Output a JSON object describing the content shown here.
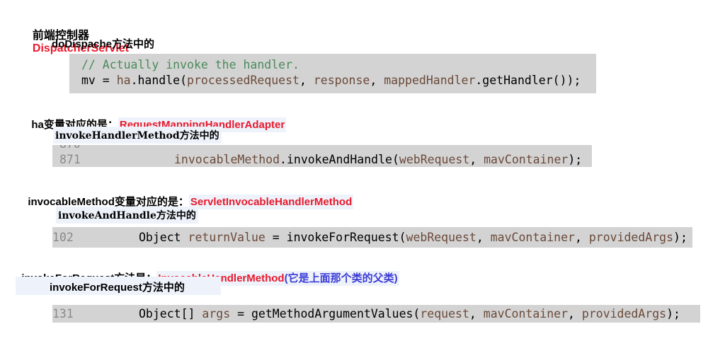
{
  "h1": {
    "prefix": "前端控制器",
    "name": "DispatcherServlet"
  },
  "h2": "doDispache方法中的",
  "code1": {
    "comment": "// Actually invoke the handler.",
    "l2_a": "mv",
    "l2_b": " = ",
    "l2_c": "ha",
    "l2_d": ".handle(",
    "l2_e": "processedRequest",
    "l2_f": ", ",
    "l2_g": "response",
    "l2_h": ", ",
    "l2_i": "mappedHandler",
    "l2_j": ".getHandler());"
  },
  "h3": {
    "prefix": "ha变量对应的是：",
    "name": "RequestMappingHandlerAdapter"
  },
  "h4": "invokeHandlerMethod方法中的",
  "code2": {
    "prev_ln": "870",
    "ln": "871",
    "a": "invocableMethod",
    "b": ".invokeAndHandle(",
    "c": "webRequest",
    "d": ", ",
    "e": "mavContainer",
    "f": ");"
  },
  "h5": {
    "prefix": "invocableMethod变量对应的是：",
    "name": "ServletInvocableHandlerMethod"
  },
  "h6": "invokeAndHandle方法中的",
  "code3": {
    "ln": "102",
    "a": "Object ",
    "b": "returnValue",
    "c": " = invokeForRequest(",
    "d": "webRequest",
    "e": ", ",
    "f": "mavContainer",
    "g": ", ",
    "h": "providedArgs",
    "i": ");"
  },
  "h7": {
    "prefix": "invokeForRequest方法是：",
    "name": "InvocableHandlerMethod",
    "note": "(它是上面那个类的父类)"
  },
  "h8": "invokeForRequest方法中的",
  "code4": {
    "ln": "131",
    "a": "Object[] ",
    "b": "args",
    "c": " = getMethodArgumentValues(",
    "d": "request",
    "e": ", ",
    "f": "mavContainer",
    "g": ", ",
    "h": "providedArgs",
    "i": ");"
  }
}
